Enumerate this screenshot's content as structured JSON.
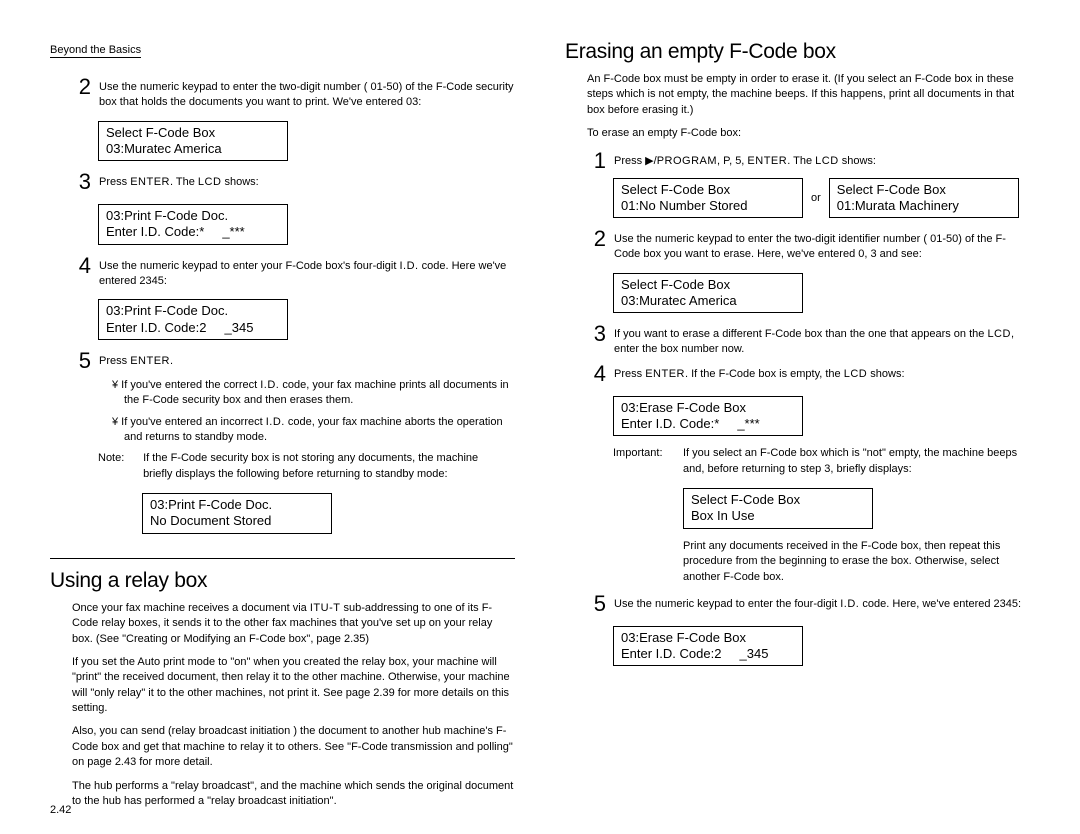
{
  "header": "Beyond the Basics",
  "pageNumber": "2.42",
  "left": {
    "step2": {
      "text": "Use the numeric keypad to enter the two-digit number (    01-50) of the F-Code security box that holds the documents you want to print. We've entered     03:",
      "lcd1": "Select F-Code Box",
      "lcd2": "03:Muratec America"
    },
    "step3": {
      "text_a": "Press ",
      "enter": "ENTER",
      "text_b": ". The ",
      "lcd_word": "LCD",
      "text_c": " shows:",
      "lcd1": "03:Print F-Code Doc.",
      "lcd2": "Enter I.D. Code:*     _***"
    },
    "step4": {
      "text_a": "Use the numeric keypad to enter your F-Code box's four-digit ",
      "id_word": "I.D.",
      "text_b": " code. Here we've entered 2345:",
      "lcd1": "03:Print F-Code Doc.",
      "lcd2": "Enter I.D. Code:2     _345"
    },
    "step5": {
      "text_a": "Press ",
      "enter": "ENTER",
      "text_b": ".",
      "b1_a": "¥  If you've entered the correct ",
      "b1_id": "I.D.",
      "b1_b": " code, your fax machine prints all documents in the F-Code security box and then erases them.",
      "b2_a": "¥  If you've entered an incorrect ",
      "b2_id": "I.D.",
      "b2_b": " code, your fax machine aborts the operation and returns to standby mode.",
      "note_lbl": "Note:",
      "note_body": "If the F-Code security box is not storing any documents, the machine briefly displays the following before returning to standby mode:",
      "lcd1": "03:Print F-Code Doc.",
      "lcd2": "No Document Stored"
    },
    "relay": {
      "title": "Using a relay box",
      "p1_a": "Once your fax machine receives a document via ",
      "itu": "ITU-T",
      "p1_b": " sub-addressing to one of its F-Code relay boxes, it sends it to the other fax machines that you've set up on your relay box. (See \"Creating or Modifying an F-Code box\", page 2.35)",
      "p2": "If you set the Auto print mode to \"on\" when you created the relay box, your machine will \"print\" the received document, then relay it to the other machine. Otherwise, your machine will \"only relay\" it to the other machines, not print it. See page 2.39 for more details on this setting.",
      "p3": "Also, you can send (relay broadcast initiation ) the document to another hub machine's F-Code box and get that machine to relay it to others. See \"F-Code transmission and polling\" on page 2.43 for more detail.",
      "p4": "The hub performs a \"relay broadcast\", and the machine which sends the original document to the hub has performed a \"relay broadcast initiation\"."
    }
  },
  "right": {
    "title": "Erasing an empty F-Code box",
    "intro": "An F-Code box must be empty in order to erase it. (If you select an F-Code box in these steps which is not empty, the machine beeps. If this happens, print all documents in that box before erasing it.)",
    "lead": "To erase an empty F-Code box:",
    "step1": {
      "text_a": "Press ▶/",
      "prog": "PROGRAM",
      "text_b": ", P, 5, ",
      "enter": "ENTER",
      "text_c": ". The ",
      "lcd_word": "LCD",
      "text_d": " shows:",
      "lcdA1": "Select F-Code Box",
      "lcdA2": "01:No Number Stored",
      "or": "or",
      "lcdB1": "Select F-Code Box",
      "lcdB2": "01:Murata Machinery"
    },
    "step2": {
      "text": "Use the numeric keypad to enter the two-digit identifier number (    01-50) of the F-Code box you want to erase. Here, we've entered  0, 3 and see:",
      "lcd1": "Select F-Code Box",
      "lcd2": "03:Muratec America"
    },
    "step3": {
      "text_a": "If you want to erase a different F-Code box than the one that appears on the ",
      "lcd_word": "LCD",
      "text_b": ", enter the box number now."
    },
    "step4": {
      "text_a": "Press ",
      "enter": "ENTER",
      "text_b": ". If the F-Code box is empty, the ",
      "lcd_word": "LCD",
      "text_c": " shows:",
      "lcd1": "03:Erase F-Code Box",
      "lcd2": "Enter I.D. Code:*     _***",
      "imp_lbl": "Important:",
      "imp_body": "If you select an F-Code box which is \"not\" empty, the machine beeps and, before returning to step 3, briefly displays:",
      "lcdI1": "Select F-Code Box",
      "lcdI2": "Box In Use",
      "after": "Print any documents received in the F-Code box, then repeat this procedure from the beginning to erase the box. Otherwise, select another F-Code box."
    },
    "step5": {
      "text_a": "Use the numeric keypad to enter the four-digit ",
      "id_word": "I.D.",
      "text_b": " code. Here, we've entered 2345:",
      "lcd1": "03:Erase F-Code Box",
      "lcd2": "Enter I.D. Code:2     _345"
    }
  }
}
